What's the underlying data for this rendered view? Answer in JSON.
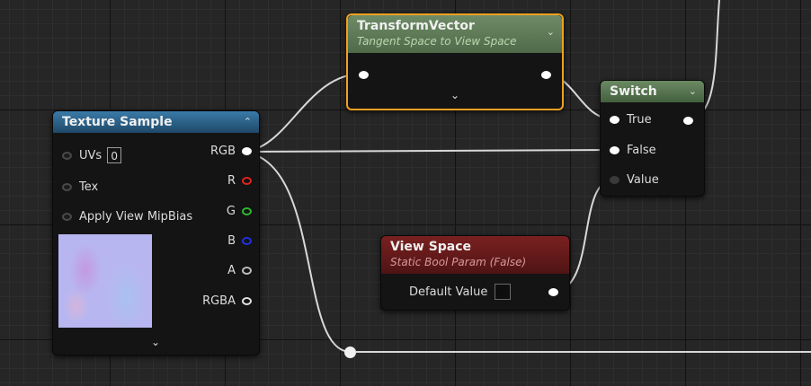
{
  "nodes": {
    "texture_sample": {
      "title": "Texture Sample",
      "inputs": {
        "uvs": "UVs",
        "uvs_value": "0",
        "tex": "Tex",
        "mipbias": "Apply View MipBias"
      },
      "outputs": {
        "rgb": "RGB",
        "r": "R",
        "g": "G",
        "b": "B",
        "a": "A",
        "rgba": "RGBA"
      }
    },
    "transform_vector": {
      "title": "TransformVector",
      "subtitle": "Tangent Space to View Space"
    },
    "switch": {
      "title": "Switch",
      "inputs": {
        "true": "True",
        "false": "False",
        "value": "Value"
      }
    },
    "view_space": {
      "title": "View Space",
      "subtitle": "Static Bool Param (False)",
      "default_label": "Default Value"
    }
  },
  "icons": {
    "collapse": "⌃",
    "expand": "⌄"
  },
  "colors": {
    "texture_header": "#2b5f85",
    "transform_header": "#5e7a57",
    "switch_header": "#4e6a49",
    "viewspace_header": "#6e1d1d",
    "selection": "#f0a020",
    "pin_r": "#e0231f",
    "pin_g": "#2fb82f",
    "pin_b": "#2030e0"
  }
}
